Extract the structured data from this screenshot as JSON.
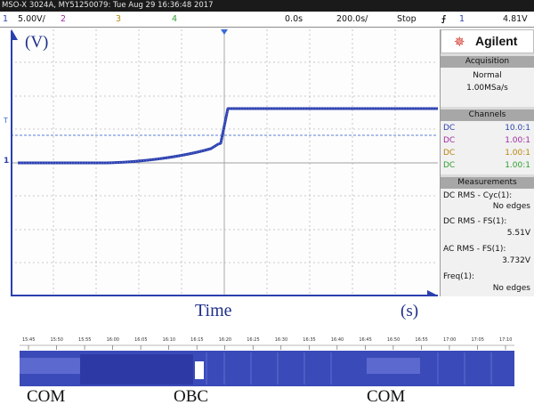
{
  "title_bar": "MSO-X 3024A, MY51250079: Tue Aug 29 16:36:48 2017",
  "channel_bar": {
    "ch1_num": "1",
    "ch1_scale": "5.00V/",
    "ch2_num": "2",
    "ch3_num": "3",
    "ch4_num": "4",
    "time_offset": "0.0s",
    "time_scale": "200.0s/",
    "run_state": "Stop",
    "trigger_icon": "trigger-edge-icon",
    "trigger_source": "1",
    "trigger_level": "4.81V"
  },
  "screen": {
    "y_unit": "(V)",
    "x_unit": "(s)",
    "x_title": "Time",
    "trigger_marker": "T",
    "ch1_marker": "1"
  },
  "sidebar": {
    "brand": "Agilent",
    "acquisition": {
      "header": "Acquisition",
      "mode": "Normal",
      "rate": "1.00MSa/s"
    },
    "channels": {
      "header": "Channels",
      "rows": [
        {
          "coupling": "DC",
          "probe": "10.0:1",
          "color": "#2a3fae"
        },
        {
          "coupling": "DC",
          "probe": "1.00:1",
          "color": "#a02ca0"
        },
        {
          "coupling": "DC",
          "probe": "1.00:1",
          "color": "#b8860b"
        },
        {
          "coupling": "DC",
          "probe": "1.00:1",
          "color": "#2e9e2e"
        }
      ]
    },
    "measurements": {
      "header": "Measurements",
      "items": [
        {
          "name": "DC RMS - Cyc(1):",
          "value": "No edges"
        },
        {
          "name": "DC RMS - FS(1):",
          "value": "5.51V"
        },
        {
          "name": "AC RMS - FS(1):",
          "value": "3.732V"
        },
        {
          "name": "Freq(1):",
          "value": "No edges"
        }
      ]
    }
  },
  "timeline": {
    "ticks": [
      "15:45",
      "15:50",
      "15:55",
      "16:00",
      "16:05",
      "16:10",
      "16:15",
      "16:20",
      "16:25",
      "16:30",
      "16:35",
      "16:40",
      "16:45",
      "16:50",
      "16:55",
      "17:00",
      "17:05",
      "17:10"
    ],
    "labels": {
      "first": "COM",
      "middle": "OBC",
      "last": "COM"
    }
  },
  "colors": {
    "trace": "#2a3fae",
    "timeline_fill": "#3a4ab8"
  }
}
